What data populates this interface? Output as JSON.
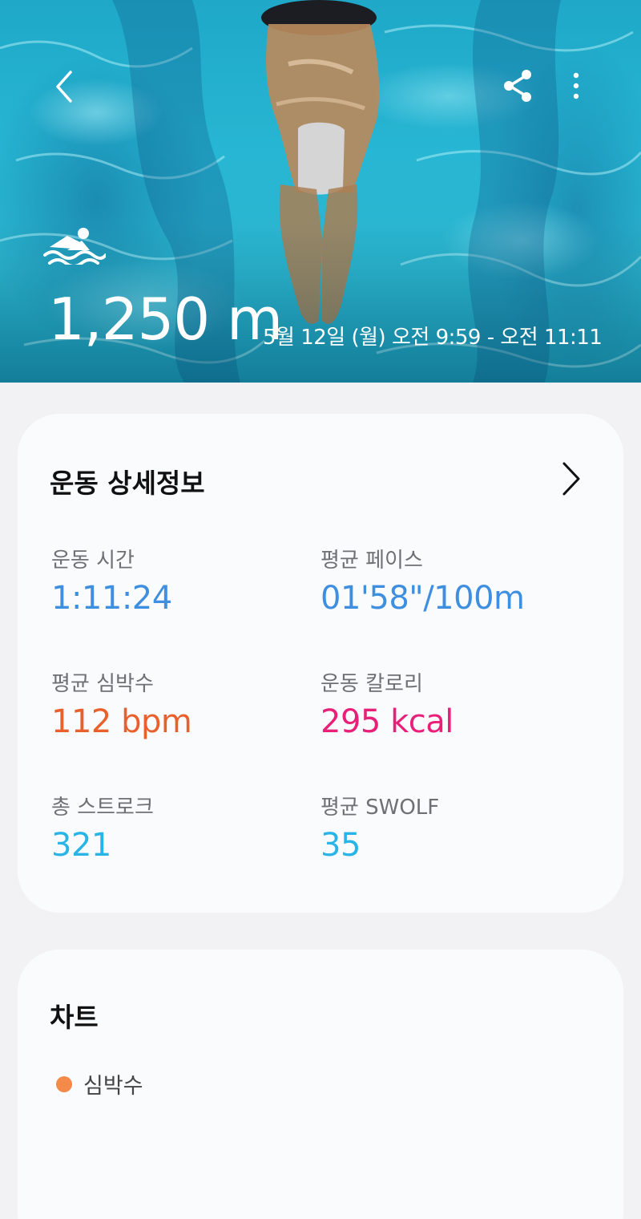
{
  "hero": {
    "distance": "1,250 m",
    "time_range": "5월 12일 (월) 오전 9:59 - 오전 11:11"
  },
  "icons": {
    "back": "back-arrow-icon",
    "share": "share-icon",
    "more": "more-vertical-icon",
    "activity": "swimming-icon",
    "detail": "chevron-right-icon"
  },
  "details": {
    "title": "운동 상세정보",
    "stats": [
      {
        "label": "운동 시간",
        "value": "1:11:24",
        "color": "#3f8fe0"
      },
      {
        "label": "평균 페이스",
        "value": "01'58\"/100m",
        "color": "#3f8fe0"
      },
      {
        "label": "평균 심박수",
        "value": "112 bpm",
        "color": "#e8612c"
      },
      {
        "label": "운동 칼로리",
        "value": "295 kcal",
        "color": "#e8207a"
      },
      {
        "label": "총 스트로크",
        "value": "321",
        "color": "#28b4e6"
      },
      {
        "label": "평균 SWOLF",
        "value": "35",
        "color": "#28b4e6"
      }
    ]
  },
  "chart": {
    "title": "차트",
    "legend": [
      {
        "label": "심박수",
        "color": "#f5894a"
      }
    ]
  }
}
